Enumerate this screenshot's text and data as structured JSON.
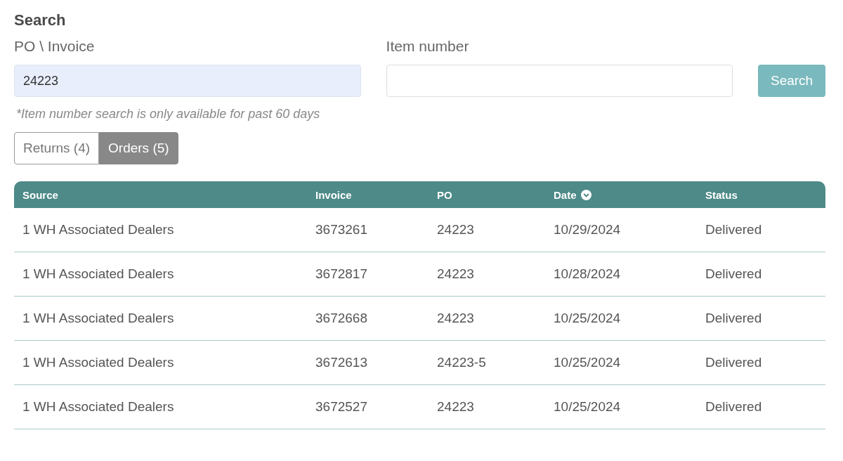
{
  "title": "Search",
  "fields": [
    {
      "label": "PO \\ Invoice",
      "value": "24223"
    },
    {
      "label": "Item number"
    }
  ],
  "search_button": "Search",
  "note": "*Item number search is only available for past 60 days",
  "tabs": [
    {
      "label": "Returns (4)",
      "selected": false
    },
    {
      "label": "Orders (5)",
      "selected": true
    }
  ],
  "table": {
    "columns": [
      {
        "label": "Source",
        "sorted": false
      },
      {
        "label": "Invoice",
        "sorted": false
      },
      {
        "label": "PO",
        "sorted": false
      },
      {
        "label": "Date",
        "sorted": true
      },
      {
        "label": "Status",
        "sorted": false
      }
    ],
    "rows": [
      [
        "1 WH Associated Dealers",
        "3673261",
        "24223",
        "10/29/2024",
        "Delivered"
      ],
      [
        "1 WH Associated Dealers",
        "3672817",
        "24223",
        "10/28/2024",
        "Delivered"
      ],
      [
        "1 WH Associated Dealers",
        "3672668",
        "24223",
        "10/25/2024",
        "Delivered"
      ],
      [
        "1 WH Associated Dealers",
        "3672613",
        "24223-5",
        "10/25/2024",
        "Delivered"
      ],
      [
        "1 WH Associated Dealers",
        "3672527",
        "24223",
        "10/25/2024",
        "Delivered"
      ]
    ]
  }
}
